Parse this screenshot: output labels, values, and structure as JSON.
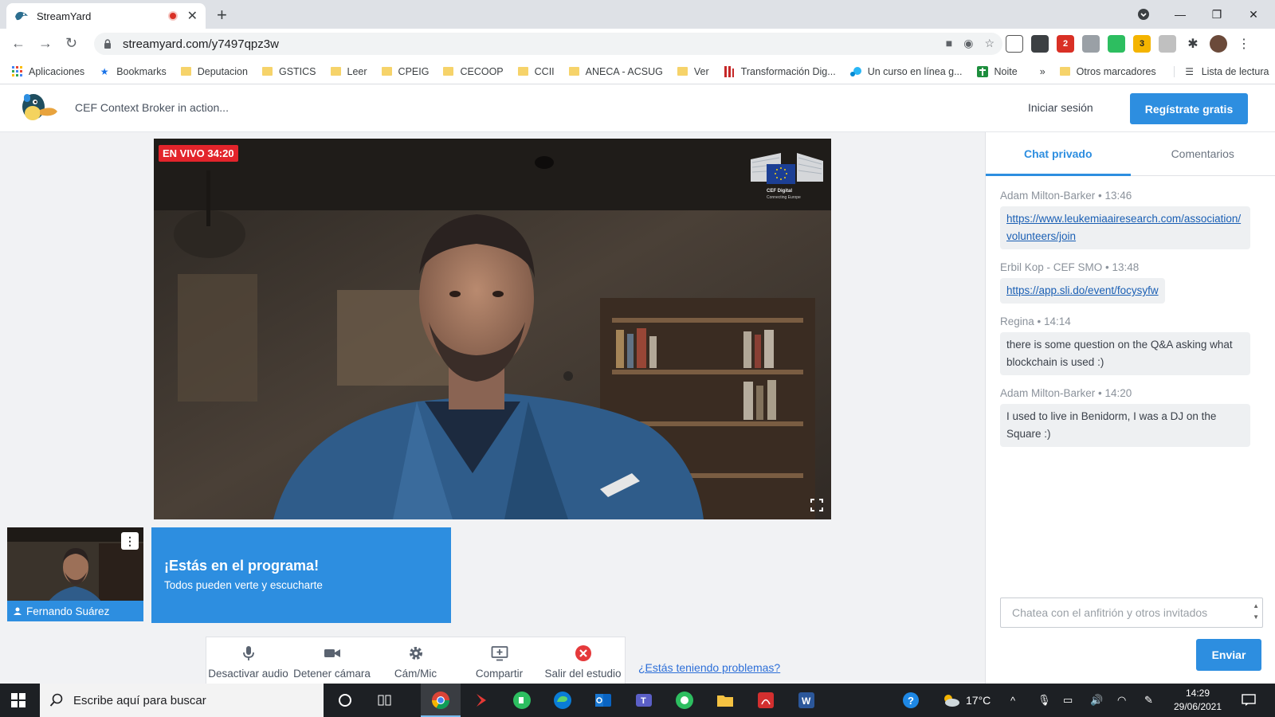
{
  "browser": {
    "tab_title": "StreamYard",
    "url": "streamyard.com/y7497qpz3w",
    "bookmarks": [
      {
        "label": "Aplicaciones",
        "icon": "apps-grid-icon"
      },
      {
        "label": "Bookmarks",
        "icon": "star-icon"
      },
      {
        "label": "Deputacion",
        "icon": "folder-icon"
      },
      {
        "label": "GSTICS",
        "icon": "folder-icon"
      },
      {
        "label": "Leer",
        "icon": "folder-icon"
      },
      {
        "label": "CPEIG",
        "icon": "folder-icon"
      },
      {
        "label": "CECOOP",
        "icon": "folder-icon"
      },
      {
        "label": "CCII",
        "icon": "folder-icon"
      },
      {
        "label": "ANECA - ACSUG",
        "icon": "folder-icon"
      },
      {
        "label": "Ver",
        "icon": "folder-icon"
      },
      {
        "label": "Transformación Dig...",
        "icon": "site-icon"
      },
      {
        "label": "Un curso en línea g...",
        "icon": "site-icon"
      },
      {
        "label": "Noite",
        "icon": "site-icon"
      }
    ],
    "more_bookmarks": "»",
    "other_bookmarks": "Otros marcadores",
    "reading_list": "Lista de lectura",
    "extension_badges": [
      "2",
      "3"
    ]
  },
  "header": {
    "broadcast_title": "CEF Context Broker in action...",
    "login": "Iniciar sesión",
    "signup": "Regístrate gratis"
  },
  "stage": {
    "live_label": "EN VIVO 34:20",
    "ec_logo_text": "CEF Digital",
    "ec_logo_sub": "Connecting Europe",
    "participant_name": "Fernando Suárez",
    "onair_title": "¡Estás en el programa!",
    "onair_subtitle": "Todos pueden verte y escucharte",
    "controls": [
      {
        "label": "Desactivar audio",
        "icon": "microphone-icon"
      },
      {
        "label": "Detener cámara",
        "icon": "camera-icon"
      },
      {
        "label": "Cám/Mic",
        "icon": "gear-icon"
      },
      {
        "label": "Compartir",
        "icon": "share-screen-icon"
      },
      {
        "label": "Salir del estudio",
        "icon": "exit-icon"
      }
    ],
    "help_link": "¿Estás teniendo problemas?"
  },
  "chat": {
    "tabs": [
      "Chat privado",
      "Comentarios"
    ],
    "active_tab": "Chat privado",
    "messages": [
      {
        "author": "Adam Milton-Barker",
        "time": "13:46",
        "text": "https://www.leukemiaairesearch.com/association/volunteers/join",
        "is_link": true
      },
      {
        "author": "Erbil Kop - CEF SMO",
        "time": "13:48",
        "text": "https://app.sli.do/event/focysyfw",
        "is_link": true
      },
      {
        "author": "Regina",
        "time": "14:14",
        "text": "there is some question on the Q&A asking what blockchain is used :)",
        "is_link": false
      },
      {
        "author": "Adam Milton-Barker",
        "time": "14:20",
        "text": "I used to live in Benidorm, I was a DJ on the Square :)",
        "is_link": false
      }
    ],
    "input_placeholder": "Chatea con el anfitrión y otros invitados",
    "send": "Enviar"
  },
  "taskbar": {
    "search_placeholder": "Escribe aquí para buscar",
    "temperature": "17°C",
    "time": "14:29",
    "date": "29/06/2021"
  },
  "colors": {
    "accent": "#2d8ee0",
    "live": "#e3242b",
    "panel_bg": "#f1f2f4"
  }
}
